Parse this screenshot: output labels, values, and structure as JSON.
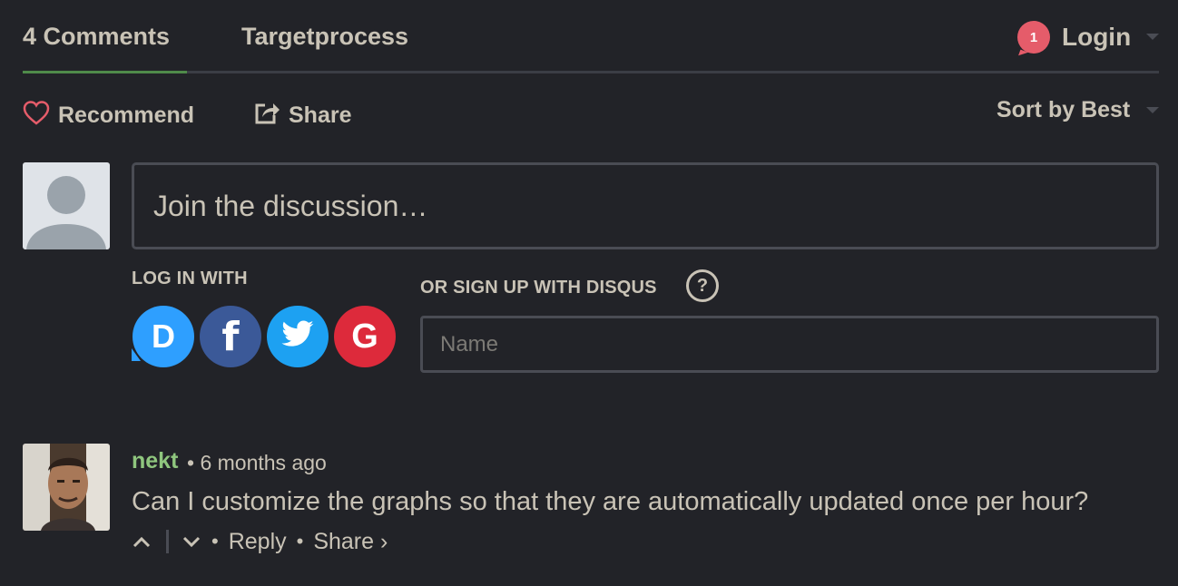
{
  "nav": {
    "comments_tab": "4 Comments",
    "community_tab": "Targetprocess",
    "notification_count": "1",
    "login_label": "Login"
  },
  "actions": {
    "recommend_label": "Recommend",
    "share_label": "Share",
    "sort_label": "Sort by Best"
  },
  "composer": {
    "placeholder": "Join the discussion…",
    "login_with_label": "LOG IN WITH",
    "signup_label": "OR SIGN UP WITH DISQUS",
    "help_label": "?",
    "name_placeholder": "Name",
    "social_providers": [
      {
        "name": "Disqus",
        "letter": "D",
        "color": "#2e9fff"
      },
      {
        "name": "Facebook",
        "letter": "f",
        "color": "#3b5998"
      },
      {
        "name": "Twitter",
        "letter": "",
        "color": "#1da1f2"
      },
      {
        "name": "Google",
        "letter": "G",
        "color": "#dd2a3b"
      }
    ]
  },
  "comment": {
    "author": "nekt",
    "meta": "• 6 months ago",
    "body": "Can I customize the graphs so that they are automatically updated once per hour?",
    "reply_label": "Reply",
    "share_label": "Share ›",
    "separator": "•"
  },
  "colors": {
    "background": "#222328",
    "text": "#c9c3b6",
    "active_tab": "#4f8a4a",
    "author": "#8fc67e",
    "badge": "#e55c6a"
  }
}
